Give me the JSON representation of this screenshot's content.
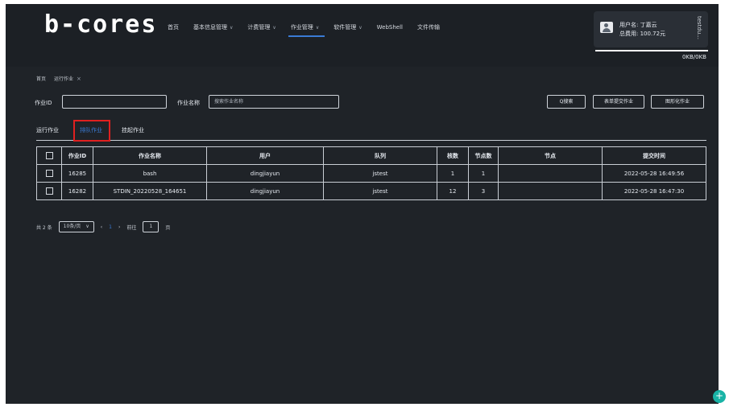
{
  "logo": "b-cores",
  "nav": [
    {
      "label": "首页",
      "dropdown": false
    },
    {
      "label": "基本信息管理",
      "dropdown": true
    },
    {
      "label": "计费管理",
      "dropdown": true
    },
    {
      "label": "作业管理",
      "dropdown": true,
      "active": true
    },
    {
      "label": "软件管理",
      "dropdown": true
    },
    {
      "label": "WebShell",
      "dropdown": false
    },
    {
      "label": "文件传输",
      "dropdown": false
    }
  ],
  "user": {
    "name_line": "用户名: 丁嘉云",
    "cost_line": "总费用: 100.72元",
    "side_text": "testdu..."
  },
  "quota": "0KB/0KB",
  "breadcrumb": {
    "home": "首页",
    "current": "运行作业",
    "close": "×"
  },
  "filters": {
    "job_id_label": "作业ID",
    "job_id_value": "",
    "job_name_label": "作业名称",
    "job_name_placeholder": "搜索作业名称",
    "search_button": "Q搜索",
    "submit_button": "表单提交作业",
    "graphic_button": "图形化作业"
  },
  "tabs": [
    "运行作业",
    "排队作业",
    "挂起作业"
  ],
  "table": {
    "headers": [
      "作业ID",
      "作业名称",
      "用户",
      "队列",
      "核数",
      "节点数",
      "节点",
      "提交时间"
    ],
    "rows": [
      [
        "16285",
        "bash",
        "dingjiayun",
        "jstest",
        "1",
        "1",
        "",
        "2022-05-28 16:49:56"
      ],
      [
        "16282",
        "STDIN_20220528_164651",
        "dingjiayun",
        "jstest",
        "12",
        "3",
        "",
        "2022-05-28 16:47:30"
      ]
    ]
  },
  "pagination": {
    "total": "共 2 条",
    "page_size": "10条/页",
    "prev": "‹",
    "current": "1",
    "next": "›",
    "goto_label": "前往",
    "goto_value": "1",
    "page_unit": "页"
  },
  "fab": "+",
  "colors": {
    "accent": "#3a7bd5",
    "highlight": "#e02020",
    "fab": "#19b3a6"
  }
}
